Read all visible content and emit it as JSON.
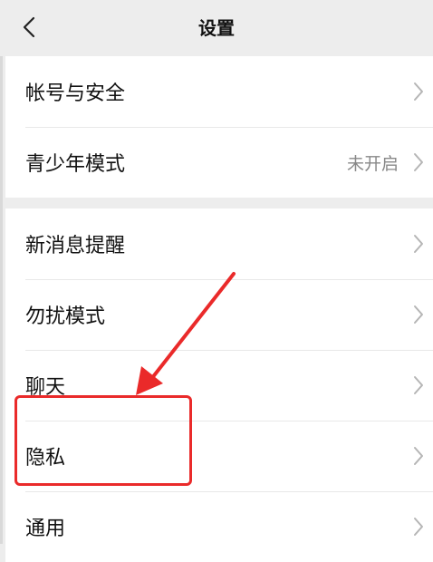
{
  "header": {
    "title": "设置",
    "back_icon": "chevron-left-icon"
  },
  "groups": [
    {
      "items": [
        {
          "label": "帐号与安全",
          "value": ""
        },
        {
          "label": "青少年模式",
          "value": "未开启"
        }
      ]
    },
    {
      "items": [
        {
          "label": "新消息提醒",
          "value": ""
        },
        {
          "label": "勿扰模式",
          "value": ""
        },
        {
          "label": "聊天",
          "value": ""
        },
        {
          "label": "隐私",
          "value": ""
        },
        {
          "label": "通用",
          "value": ""
        }
      ]
    }
  ],
  "annotation": {
    "highlight_color": "#ea2a2a",
    "arrow_icon": "red-arrow-icon",
    "highlighted_item": "隐私"
  },
  "colors": {
    "background": "#ededed",
    "row_background": "#ffffff",
    "text": "#111111",
    "secondary_text": "#888888"
  }
}
